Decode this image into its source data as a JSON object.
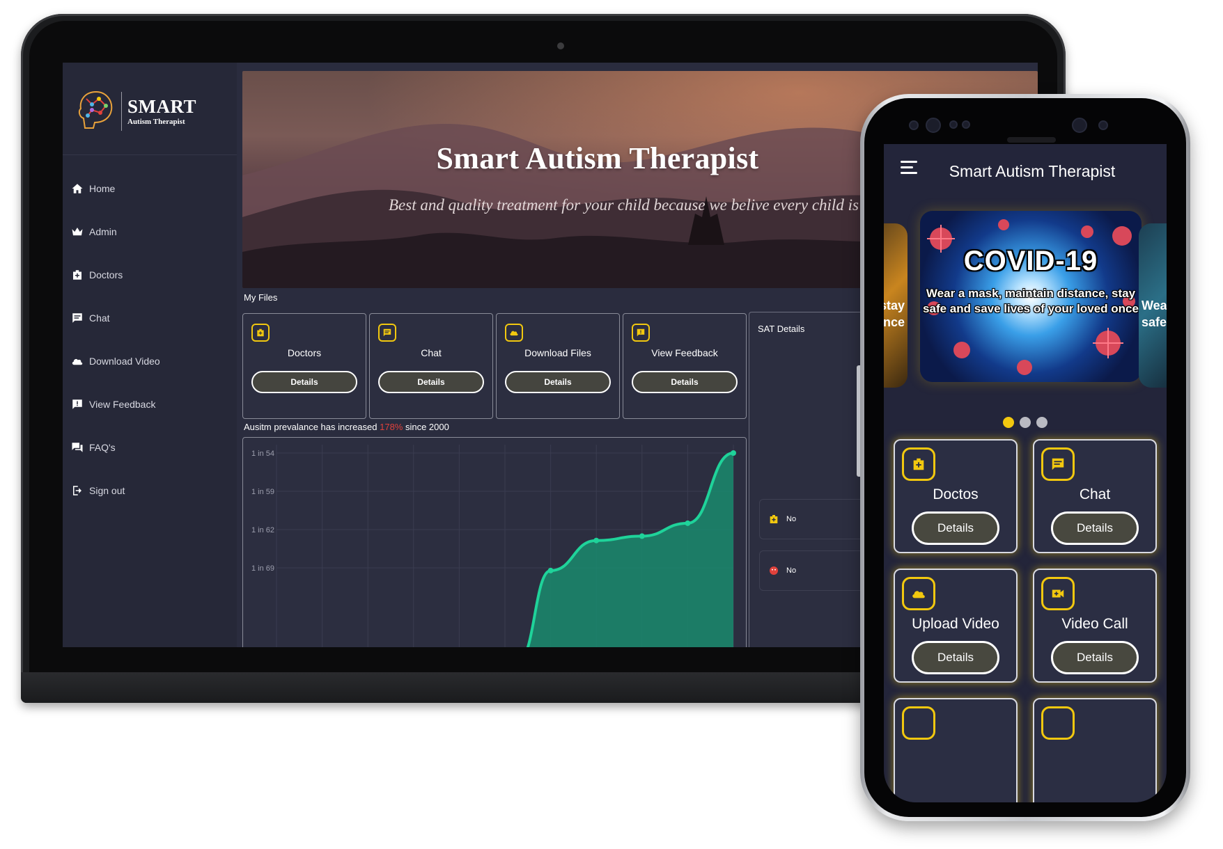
{
  "web": {
    "logo": {
      "title": "SMART",
      "subtitle": "Autism Therapist"
    },
    "nav": [
      {
        "label": "Home",
        "icon": "home-icon"
      },
      {
        "label": "Admin",
        "icon": "crown-icon"
      },
      {
        "label": "Doctors",
        "icon": "medkit-icon"
      },
      {
        "label": "Chat",
        "icon": "chat-icon"
      },
      {
        "label": "Download Video",
        "icon": "cloud-icon"
      },
      {
        "label": "View Feedback",
        "icon": "feedback-icon"
      },
      {
        "label": "FAQ's",
        "icon": "forum-icon"
      },
      {
        "label": "Sign out",
        "icon": "logout-icon"
      }
    ],
    "hero": {
      "title": "Smart Autism Therapist",
      "subtitle": "Best and quality treatment for your child because we belive every child is special"
    },
    "files_label": "My Files",
    "file_cards": [
      {
        "title": "Doctors",
        "button": "Details",
        "icon": "medkit-icon"
      },
      {
        "title": "Chat",
        "button": "Details",
        "icon": "chat-icon"
      },
      {
        "title": "Download Files",
        "button": "Details",
        "icon": "cloud-icon"
      },
      {
        "title": "View Feedback",
        "button": "Details",
        "icon": "feedback-icon"
      }
    ],
    "sat": {
      "title": "SAT Details",
      "rows": [
        {
          "text": "No",
          "icon": "medkit-icon"
        },
        {
          "text": "No",
          "icon": "face-icon"
        }
      ]
    },
    "chart_caption": {
      "before": "Ausitm prevalance has increased ",
      "highlight": "178%",
      "after": " since 2000"
    },
    "colors": {
      "accent": "#f2c80f",
      "highlight": "#e0413b",
      "chart_line": "#1fd39a",
      "chart_fill": "#1a8a6d"
    }
  },
  "chart_data": {
    "type": "area",
    "title": "",
    "xlabel": "",
    "ylabel": "",
    "y_tick_labels": [
      "1 in 54",
      "1 in 59",
      "1 in 62",
      "1 in 69"
    ],
    "y_tick_values": [
      54,
      59,
      62,
      69
    ],
    "x": [
      1,
      2,
      3,
      4,
      5,
      6,
      7,
      8,
      9,
      10,
      11
    ],
    "series": [
      {
        "values": [
          null,
          null,
          null,
          null,
          null,
          null,
          69.5,
          64,
          63.2,
          61.5,
          54
        ]
      }
    ],
    "grid": true
  },
  "mobile": {
    "title": "Smart Autism Therapist",
    "slides": {
      "main_title": "COVID-19",
      "main_line1": "Wear a mask, maintain distance, stay",
      "main_line2": "safe and save lives of your loved once",
      "left_peek_line1": "stay",
      "left_peek_line2": "once",
      "right_peek_line1": "Wea",
      "right_peek_line2": "safe"
    },
    "dots_count": 3,
    "active_dot": 0,
    "cards": [
      {
        "title": "Doctos",
        "button": "Details",
        "icon": "medkit-icon"
      },
      {
        "title": "Chat",
        "button": "Details",
        "icon": "chat-icon"
      },
      {
        "title": "Upload Video",
        "button": "Details",
        "icon": "cloud-icon"
      },
      {
        "title": "Video Call",
        "button": "Details",
        "icon": "video-call-icon"
      }
    ]
  }
}
